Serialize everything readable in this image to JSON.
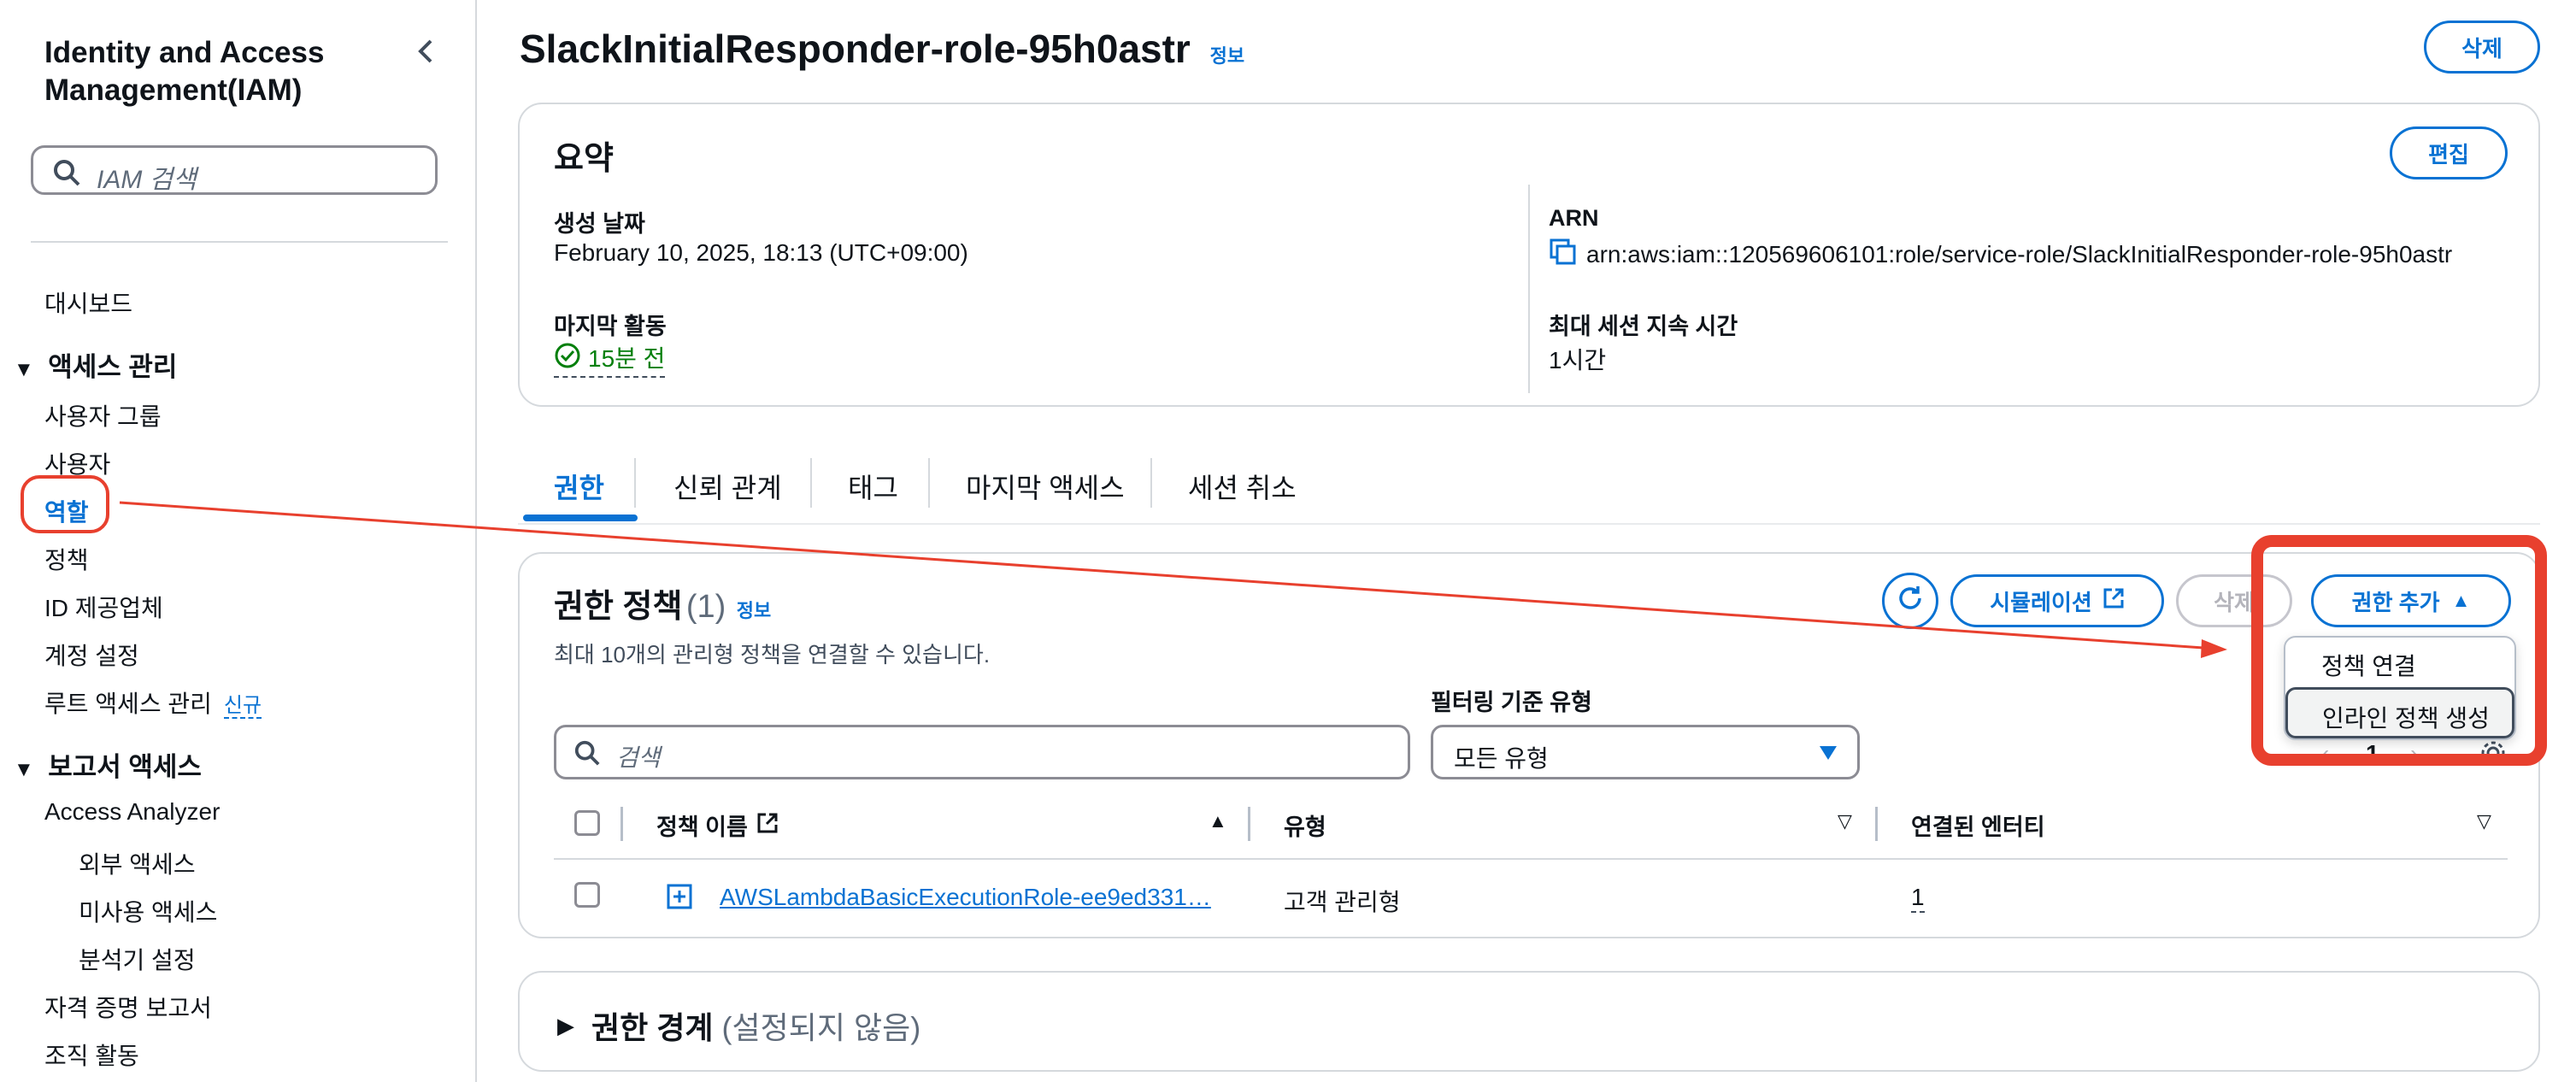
{
  "sidebar": {
    "title": "Identity and Access Management(IAM)",
    "search_placeholder": "IAM 검색",
    "items": {
      "dashboard": "대시보드",
      "access_mgmt": "액세스 관리",
      "user_groups": "사용자 그룹",
      "users": "사용자",
      "roles": "역할",
      "policies": "정책",
      "id_providers": "ID 제공업체",
      "account_settings": "계정 설정",
      "root_access": "루트 액세스 관리",
      "new_badge": "신규",
      "report_access": "보고서 액세스",
      "access_analyzer": "Access Analyzer",
      "external_access": "외부 액세스",
      "unused_access": "미사용 액세스",
      "analyzer_settings": "분석기 설정",
      "credential_report": "자격 증명 보고서",
      "org_activity": "조직 활동"
    }
  },
  "page": {
    "title": "SlackInitialResponder-role-95h0astr",
    "info": "정보",
    "delete_button": "삭제"
  },
  "summary": {
    "heading": "요약",
    "edit_button": "편집",
    "created_label": "생성 날짜",
    "created_value": "February 10, 2025, 18:13 (UTC+09:00)",
    "last_activity_label": "마지막 활동",
    "last_activity_value": "15분 전",
    "arn_label": "ARN",
    "arn_value": "arn:aws:iam::120569606101:role/service-role/SlackInitialResponder-role-95h0astr",
    "max_session_label": "최대 세션 지속 시간",
    "max_session_value": "1시간"
  },
  "tabs": [
    "권한",
    "신뢰 관계",
    "태그",
    "마지막 액세스",
    "세션 취소"
  ],
  "permissions": {
    "heading": "권한 정책",
    "count": "(1)",
    "info": "정보",
    "description": "최대 10개의 관리형 정책을 연결할 수 있습니다.",
    "simulate_button": "시뮬레이션",
    "delete_button": "삭제",
    "add_button": "권한 추가",
    "search_placeholder": "검색",
    "filter_label": "필터링 기준 유형",
    "filter_value": "모든 유형",
    "page_number": "1",
    "columns": [
      "정책 이름",
      "유형",
      "연결된 엔터티"
    ],
    "rows": [
      {
        "name": "AWSLambdaBasicExecutionRole-ee9ed331…",
        "type": "고객 관리형",
        "entities": "1"
      }
    ],
    "menu": [
      "정책 연결",
      "인라인 정책 생성"
    ]
  },
  "boundary": {
    "heading": "권한 경계",
    "status": "(설정되지 않음)"
  },
  "colors": {
    "link": "#0972d3",
    "success": "#037f0c",
    "annotation": "#e8402e"
  }
}
